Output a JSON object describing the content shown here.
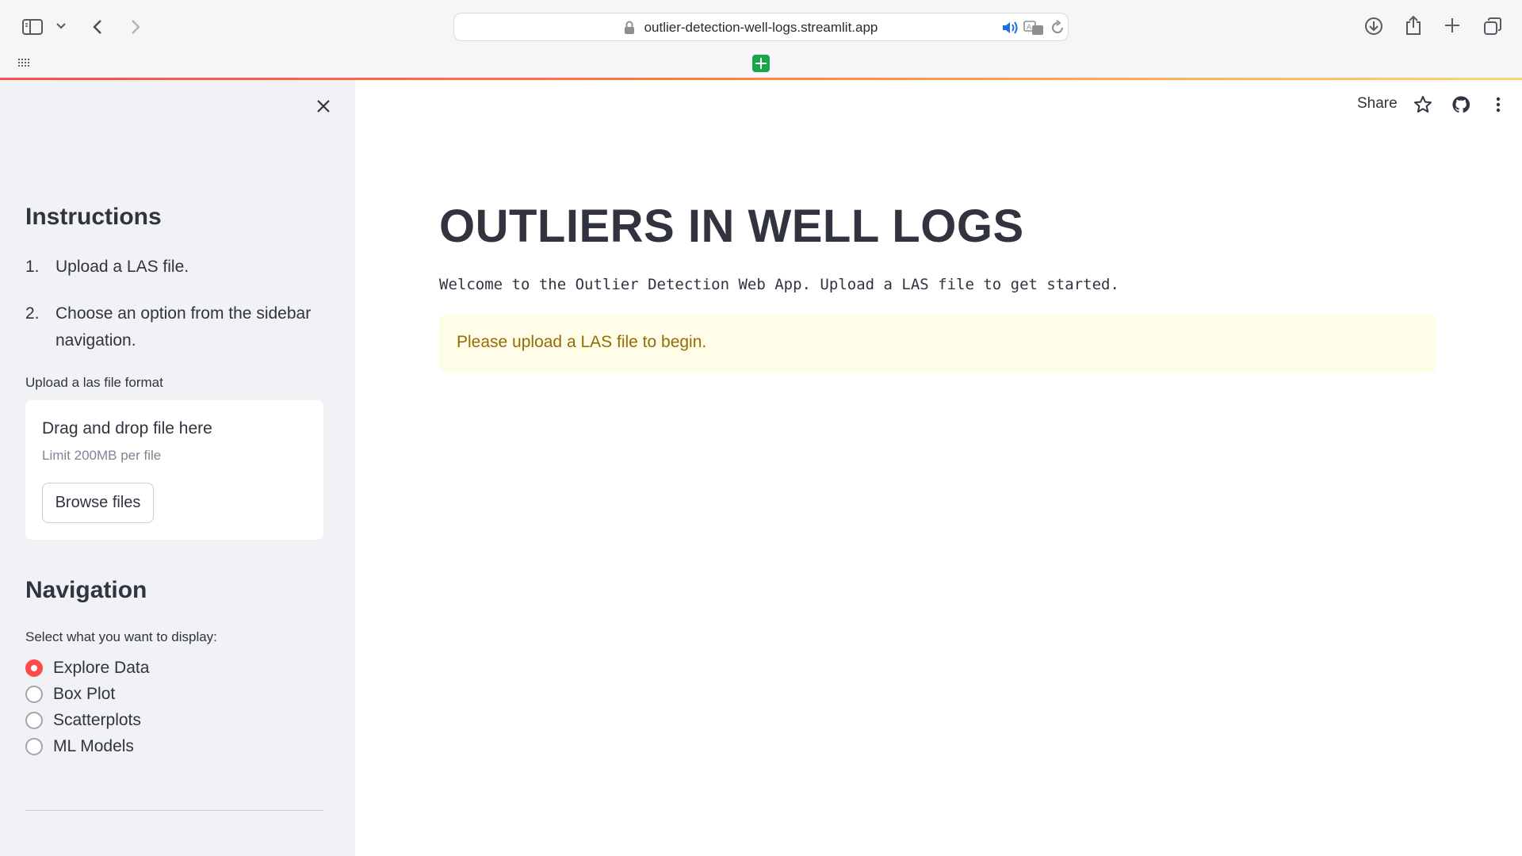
{
  "browser": {
    "url": "outlier-detection-well-logs.streamlit.app"
  },
  "app_toolbar": {
    "share_label": "Share"
  },
  "sidebar": {
    "instructions_title": "Instructions",
    "steps": [
      {
        "num": "1.",
        "text": "Upload a LAS file."
      },
      {
        "num": "2.",
        "text": "Choose an option from the sidebar navigation."
      }
    ],
    "upload_label": "Upload a las file format",
    "uploader": {
      "title": "Drag and drop file here",
      "limit": "Limit 200MB per file",
      "button": "Browse files"
    },
    "navigation_title": "Navigation",
    "select_label": "Select what you want to display:",
    "options": [
      {
        "label": "Explore Data",
        "selected": true
      },
      {
        "label": "Box Plot",
        "selected": false
      },
      {
        "label": "Scatterplots",
        "selected": false
      },
      {
        "label": "ML Models",
        "selected": false
      }
    ]
  },
  "main": {
    "title": "OUTLIERS IN WELL LOGS",
    "welcome": "Welcome to the Outlier Detection Web App. Upload a LAS file to get started.",
    "warning": "Please upload a LAS file to begin."
  },
  "colors": {
    "accent": "#ff4b4b",
    "sidebar_bg": "#f0f2f6",
    "warning_bg": "#fffce7",
    "warning_text": "#926c05"
  }
}
